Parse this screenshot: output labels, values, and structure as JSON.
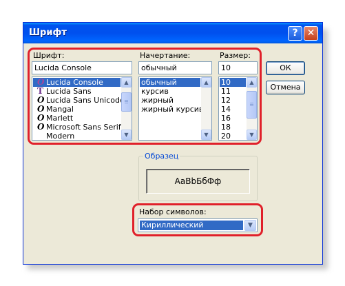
{
  "window": {
    "title": "Шрифт",
    "help_button": "?",
    "close_button": "✕"
  },
  "font": {
    "label": "Шрифт:",
    "value": "Lucida Console",
    "items": [
      {
        "name": "Lucida Console",
        "icon": "O",
        "selected": true
      },
      {
        "name": "Lucida Sans",
        "icon": "T"
      },
      {
        "name": "Lucida Sans Unicode",
        "icon": "O"
      },
      {
        "name": "Mangal",
        "icon": "O"
      },
      {
        "name": "Marlett",
        "icon": "O"
      },
      {
        "name": "Microsoft Sans Serif",
        "icon": "O"
      },
      {
        "name": "Modern",
        "icon": ""
      }
    ]
  },
  "style": {
    "label": "Начертание:",
    "value": "обычный",
    "items": [
      {
        "name": "обычный",
        "selected": true
      },
      {
        "name": "курсив"
      },
      {
        "name": "жирный"
      },
      {
        "name": "жирный курсив"
      }
    ]
  },
  "size": {
    "label": "Размер:",
    "value": "10",
    "items": [
      {
        "name": "10",
        "selected": true
      },
      {
        "name": "11"
      },
      {
        "name": "12"
      },
      {
        "name": "14"
      },
      {
        "name": "16"
      },
      {
        "name": "18"
      },
      {
        "name": "20"
      }
    ]
  },
  "buttons": {
    "ok": "ОК",
    "cancel": "Отмена"
  },
  "sample": {
    "legend": "Образец",
    "text": "AaBbБбФф"
  },
  "charset": {
    "label": "Набор символов:",
    "value": "Кириллический"
  },
  "colors": {
    "highlight": "#e0202a",
    "selection": "#316ac5",
    "titlebar": "#0050ee",
    "dialog_bg": "#ece9d8"
  }
}
